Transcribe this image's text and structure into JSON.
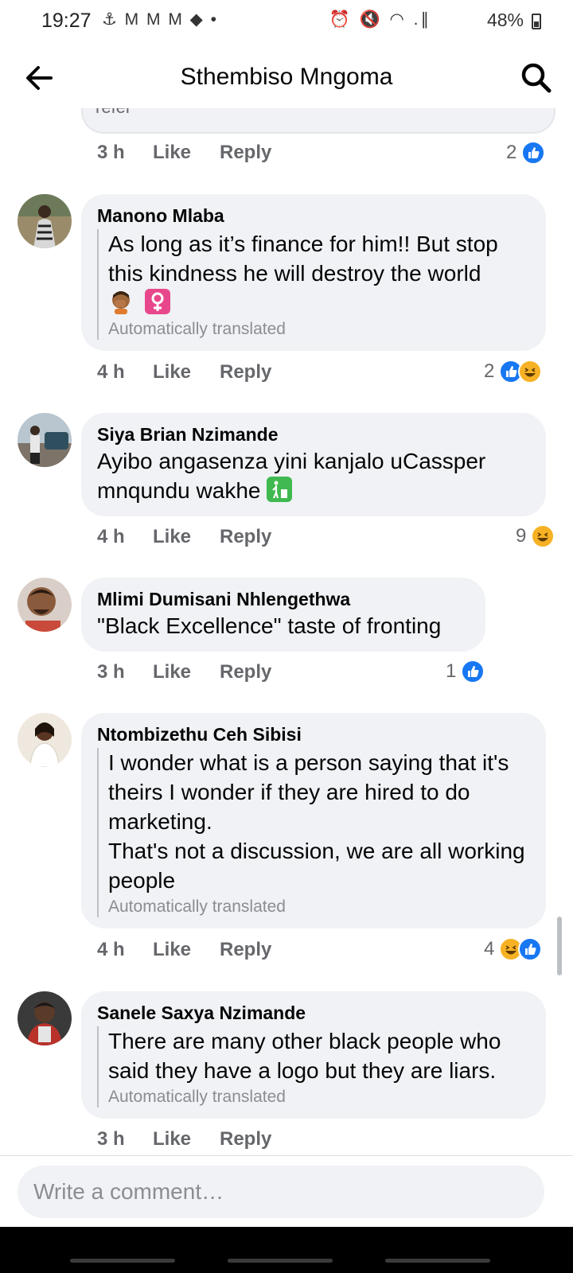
{
  "status_bar": {
    "time": "19:27",
    "notif_icons": "⚓ M M M ◆ •",
    "system_icons": "⏰ 🔇 ◠ .∥",
    "battery": "48%"
  },
  "header": {
    "title": "Sthembiso Mngoma"
  },
  "previous_comment": {
    "partial_text": "référ",
    "time": "3 h",
    "like": "Like",
    "reply": "Reply",
    "reaction_count": "2",
    "reactions": [
      "like-icon"
    ]
  },
  "comments": [
    {
      "author": "Manono Mlaba",
      "text": "As long as it’s finance for him!! But stop this kindness he will destroy the world",
      "emojis": [
        "🤦🏽‍♀️",
        "♀"
      ],
      "translated_note": "Automatically translated",
      "time": "4 h",
      "like": "Like",
      "reply": "Reply",
      "reaction_count": "2",
      "reactions": [
        "like-icon",
        "haha-icon"
      ]
    },
    {
      "author": "Siya Brian Nzimande",
      "text": "Ayibo angasenza yini kanjalo uCassper mnqundu wakhe",
      "emojis": [
        "🚮"
      ],
      "time": "4 h",
      "like": "Like",
      "reply": "Reply",
      "reaction_count": "9",
      "reactions": [
        "haha-icon"
      ]
    },
    {
      "author": "Mlimi Dumisani Nhlengethwa",
      "text": "\"Black Excellence\" taste of fronting",
      "time": "3 h",
      "like": "Like",
      "reply": "Reply",
      "reaction_count": "1",
      "reactions": [
        "like-icon"
      ]
    },
    {
      "author": "Ntombizethu Ceh Sibisi",
      "text_lines": [
        "I wonder what is a person saying that it's theirs I wonder if they are hired to do marketing.",
        "That's not a discussion, we are all working people"
      ],
      "translated_note": "Automatically translated",
      "time": "4 h",
      "like": "Like",
      "reply": "Reply",
      "reaction_count": "4",
      "reactions": [
        "haha-icon",
        "like-icon"
      ]
    },
    {
      "author": "Sanele Saxya Nzimande",
      "text": "There are many other black people who said they have a logo but they are liars.",
      "translated_note": "Automatically translated",
      "time": "3 h",
      "like": "Like",
      "reply": "Reply"
    }
  ],
  "composer": {
    "placeholder": "Write a comment…"
  },
  "colors": {
    "bubble": "#f0f2f5",
    "like_blue": "#1877f2",
    "haha_yellow": "#f7b125",
    "secondary_text": "#65676b"
  }
}
